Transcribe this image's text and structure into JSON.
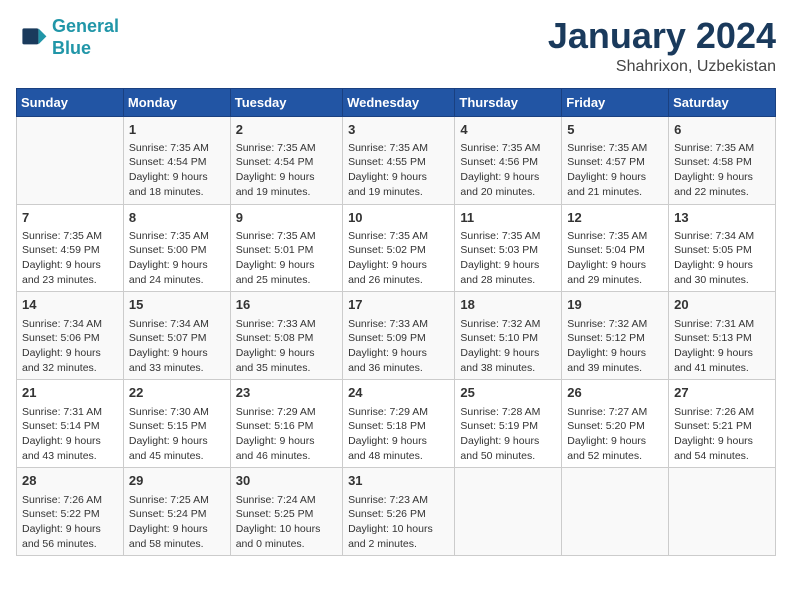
{
  "header": {
    "logo_line1": "General",
    "logo_line2": "Blue",
    "title": "January 2024",
    "subtitle": "Shahrixon, Uzbekistan"
  },
  "days_of_week": [
    "Sunday",
    "Monday",
    "Tuesday",
    "Wednesday",
    "Thursday",
    "Friday",
    "Saturday"
  ],
  "weeks": [
    [
      {
        "day": "",
        "info": ""
      },
      {
        "day": "1",
        "info": "Sunrise: 7:35 AM\nSunset: 4:54 PM\nDaylight: 9 hours\nand 18 minutes."
      },
      {
        "day": "2",
        "info": "Sunrise: 7:35 AM\nSunset: 4:54 PM\nDaylight: 9 hours\nand 19 minutes."
      },
      {
        "day": "3",
        "info": "Sunrise: 7:35 AM\nSunset: 4:55 PM\nDaylight: 9 hours\nand 19 minutes."
      },
      {
        "day": "4",
        "info": "Sunrise: 7:35 AM\nSunset: 4:56 PM\nDaylight: 9 hours\nand 20 minutes."
      },
      {
        "day": "5",
        "info": "Sunrise: 7:35 AM\nSunset: 4:57 PM\nDaylight: 9 hours\nand 21 minutes."
      },
      {
        "day": "6",
        "info": "Sunrise: 7:35 AM\nSunset: 4:58 PM\nDaylight: 9 hours\nand 22 minutes."
      }
    ],
    [
      {
        "day": "7",
        "info": "Sunrise: 7:35 AM\nSunset: 4:59 PM\nDaylight: 9 hours\nand 23 minutes."
      },
      {
        "day": "8",
        "info": "Sunrise: 7:35 AM\nSunset: 5:00 PM\nDaylight: 9 hours\nand 24 minutes."
      },
      {
        "day": "9",
        "info": "Sunrise: 7:35 AM\nSunset: 5:01 PM\nDaylight: 9 hours\nand 25 minutes."
      },
      {
        "day": "10",
        "info": "Sunrise: 7:35 AM\nSunset: 5:02 PM\nDaylight: 9 hours\nand 26 minutes."
      },
      {
        "day": "11",
        "info": "Sunrise: 7:35 AM\nSunset: 5:03 PM\nDaylight: 9 hours\nand 28 minutes."
      },
      {
        "day": "12",
        "info": "Sunrise: 7:35 AM\nSunset: 5:04 PM\nDaylight: 9 hours\nand 29 minutes."
      },
      {
        "day": "13",
        "info": "Sunrise: 7:34 AM\nSunset: 5:05 PM\nDaylight: 9 hours\nand 30 minutes."
      }
    ],
    [
      {
        "day": "14",
        "info": "Sunrise: 7:34 AM\nSunset: 5:06 PM\nDaylight: 9 hours\nand 32 minutes."
      },
      {
        "day": "15",
        "info": "Sunrise: 7:34 AM\nSunset: 5:07 PM\nDaylight: 9 hours\nand 33 minutes."
      },
      {
        "day": "16",
        "info": "Sunrise: 7:33 AM\nSunset: 5:08 PM\nDaylight: 9 hours\nand 35 minutes."
      },
      {
        "day": "17",
        "info": "Sunrise: 7:33 AM\nSunset: 5:09 PM\nDaylight: 9 hours\nand 36 minutes."
      },
      {
        "day": "18",
        "info": "Sunrise: 7:32 AM\nSunset: 5:10 PM\nDaylight: 9 hours\nand 38 minutes."
      },
      {
        "day": "19",
        "info": "Sunrise: 7:32 AM\nSunset: 5:12 PM\nDaylight: 9 hours\nand 39 minutes."
      },
      {
        "day": "20",
        "info": "Sunrise: 7:31 AM\nSunset: 5:13 PM\nDaylight: 9 hours\nand 41 minutes."
      }
    ],
    [
      {
        "day": "21",
        "info": "Sunrise: 7:31 AM\nSunset: 5:14 PM\nDaylight: 9 hours\nand 43 minutes."
      },
      {
        "day": "22",
        "info": "Sunrise: 7:30 AM\nSunset: 5:15 PM\nDaylight: 9 hours\nand 45 minutes."
      },
      {
        "day": "23",
        "info": "Sunrise: 7:29 AM\nSunset: 5:16 PM\nDaylight: 9 hours\nand 46 minutes."
      },
      {
        "day": "24",
        "info": "Sunrise: 7:29 AM\nSunset: 5:18 PM\nDaylight: 9 hours\nand 48 minutes."
      },
      {
        "day": "25",
        "info": "Sunrise: 7:28 AM\nSunset: 5:19 PM\nDaylight: 9 hours\nand 50 minutes."
      },
      {
        "day": "26",
        "info": "Sunrise: 7:27 AM\nSunset: 5:20 PM\nDaylight: 9 hours\nand 52 minutes."
      },
      {
        "day": "27",
        "info": "Sunrise: 7:26 AM\nSunset: 5:21 PM\nDaylight: 9 hours\nand 54 minutes."
      }
    ],
    [
      {
        "day": "28",
        "info": "Sunrise: 7:26 AM\nSunset: 5:22 PM\nDaylight: 9 hours\nand 56 minutes."
      },
      {
        "day": "29",
        "info": "Sunrise: 7:25 AM\nSunset: 5:24 PM\nDaylight: 9 hours\nand 58 minutes."
      },
      {
        "day": "30",
        "info": "Sunrise: 7:24 AM\nSunset: 5:25 PM\nDaylight: 10 hours\nand 0 minutes."
      },
      {
        "day": "31",
        "info": "Sunrise: 7:23 AM\nSunset: 5:26 PM\nDaylight: 10 hours\nand 2 minutes."
      },
      {
        "day": "",
        "info": ""
      },
      {
        "day": "",
        "info": ""
      },
      {
        "day": "",
        "info": ""
      }
    ]
  ]
}
